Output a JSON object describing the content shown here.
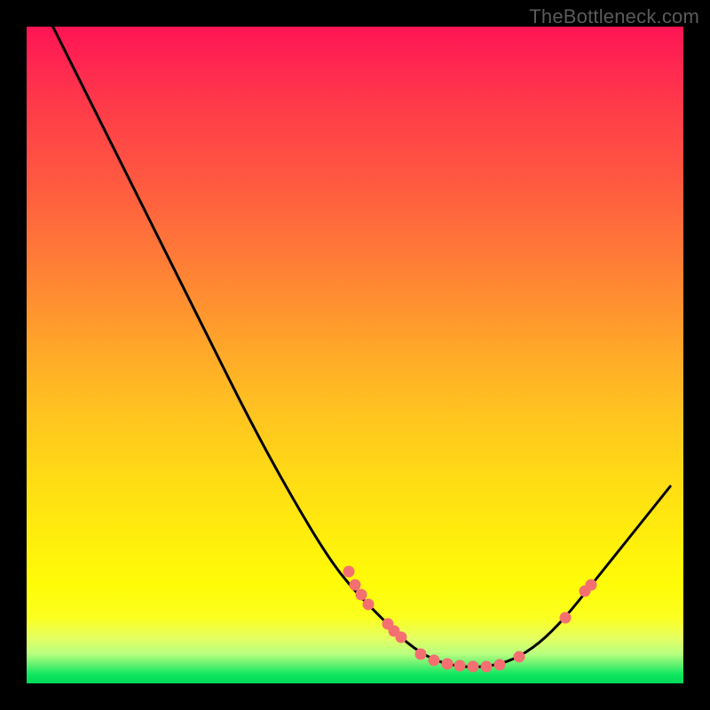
{
  "watermark": "TheBottleneck.com",
  "colors": {
    "bg": "#000000",
    "curve": "#000000",
    "marker": "#f47070",
    "gradient_top": "#ff1454",
    "gradient_bottom": "#00d85a"
  },
  "chart_data": {
    "type": "line",
    "title": "",
    "xlabel": "",
    "ylabel": "",
    "xlim": [
      0,
      100
    ],
    "ylim": [
      0,
      100
    ],
    "description": "Bottleneck curve over red-to-green vertical gradient. Y=100 at left, falling to a flat minimum near Y≈2–4 around X=60–75, rising to Y≈30 at right edge. No axis ticks or numeric labels shown.",
    "curve": [
      {
        "x": 4,
        "y": 100
      },
      {
        "x": 10,
        "y": 88
      },
      {
        "x": 16,
        "y": 76
      },
      {
        "x": 22,
        "y": 64
      },
      {
        "x": 28,
        "y": 52
      },
      {
        "x": 34,
        "y": 40
      },
      {
        "x": 40,
        "y": 29
      },
      {
        "x": 46,
        "y": 19
      },
      {
        "x": 50,
        "y": 14
      },
      {
        "x": 54,
        "y": 10
      },
      {
        "x": 58,
        "y": 6
      },
      {
        "x": 62,
        "y": 3.5
      },
      {
        "x": 66,
        "y": 2.5
      },
      {
        "x": 70,
        "y": 2.5
      },
      {
        "x": 74,
        "y": 3.5
      },
      {
        "x": 78,
        "y": 6
      },
      {
        "x": 82,
        "y": 10
      },
      {
        "x": 86,
        "y": 15
      },
      {
        "x": 90,
        "y": 20
      },
      {
        "x": 94,
        "y": 25
      },
      {
        "x": 98,
        "y": 30
      }
    ],
    "markers": [
      {
        "x": 49,
        "y": 17
      },
      {
        "x": 50,
        "y": 15
      },
      {
        "x": 51,
        "y": 13.5
      },
      {
        "x": 52,
        "y": 12
      },
      {
        "x": 55,
        "y": 9
      },
      {
        "x": 56,
        "y": 8
      },
      {
        "x": 57,
        "y": 7
      },
      {
        "x": 60,
        "y": 4.5
      },
      {
        "x": 62,
        "y": 3.5
      },
      {
        "x": 64,
        "y": 3
      },
      {
        "x": 66,
        "y": 2.7
      },
      {
        "x": 68,
        "y": 2.6
      },
      {
        "x": 70,
        "y": 2.6
      },
      {
        "x": 72,
        "y": 2.9
      },
      {
        "x": 75,
        "y": 4
      },
      {
        "x": 82,
        "y": 10
      },
      {
        "x": 85,
        "y": 14
      },
      {
        "x": 86,
        "y": 15
      }
    ]
  }
}
